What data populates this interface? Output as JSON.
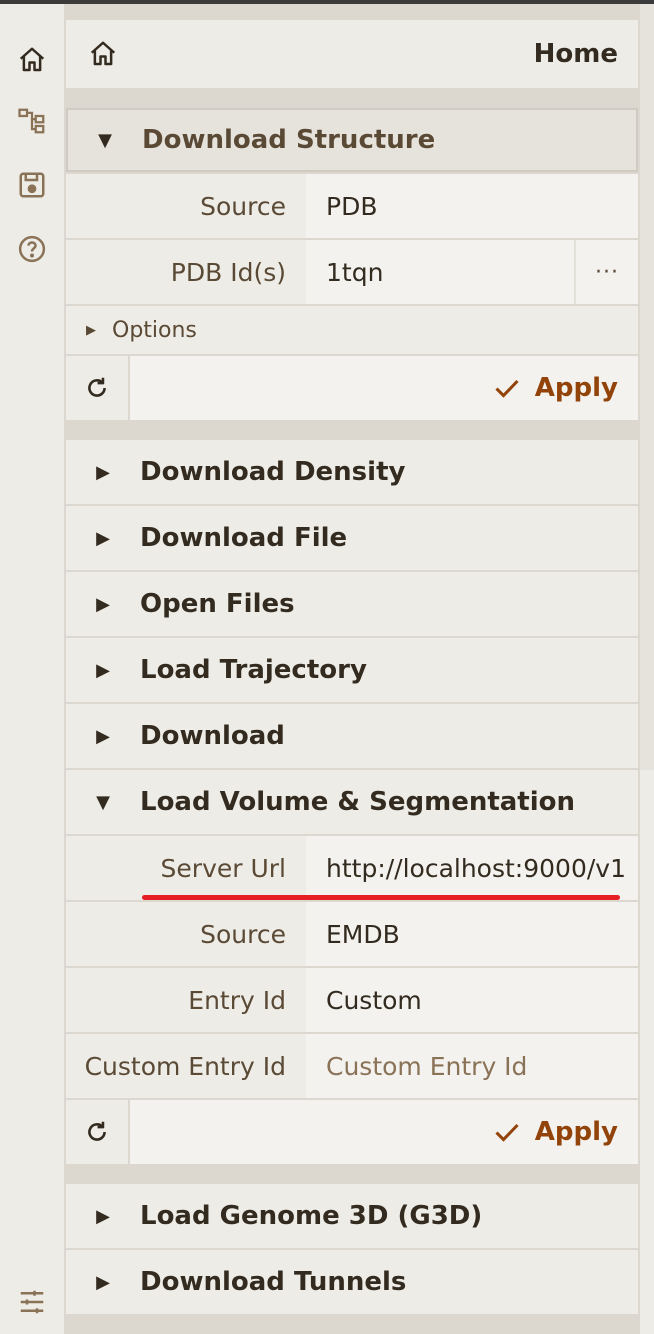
{
  "home": {
    "title": "Home"
  },
  "toolbar": {
    "icons": [
      "home-icon",
      "state-tree-icon",
      "save-icon",
      "help-icon",
      "settings-icon"
    ]
  },
  "download_structure": {
    "title": "Download Structure",
    "params": [
      {
        "label": "Source",
        "value": "PDB"
      },
      {
        "label": "PDB Id(s)",
        "value": "1tqn",
        "more": "···"
      }
    ],
    "options_label": "Options",
    "apply_label": "Apply"
  },
  "collapsed_sections": [
    "Download Density",
    "Download File",
    "Open Files",
    "Load Trajectory",
    "Download"
  ],
  "volume_segmentation": {
    "title": "Load Volume & Segmentation",
    "params": [
      {
        "label": "Server Url",
        "value": "http://localhost:9000/v1"
      },
      {
        "label": "Source",
        "value": "EMDB"
      },
      {
        "label": "Entry Id",
        "value": "Custom"
      },
      {
        "label": "Custom Entry Id",
        "placeholder": "Custom Entry Id"
      }
    ],
    "apply_label": "Apply"
  },
  "bottom_sections": [
    "Load Genome 3D (G3D)",
    "Download Tunnels"
  ],
  "colors": {
    "accent": "#924309",
    "highlight": "#e51f24",
    "text": "#332b1f"
  }
}
